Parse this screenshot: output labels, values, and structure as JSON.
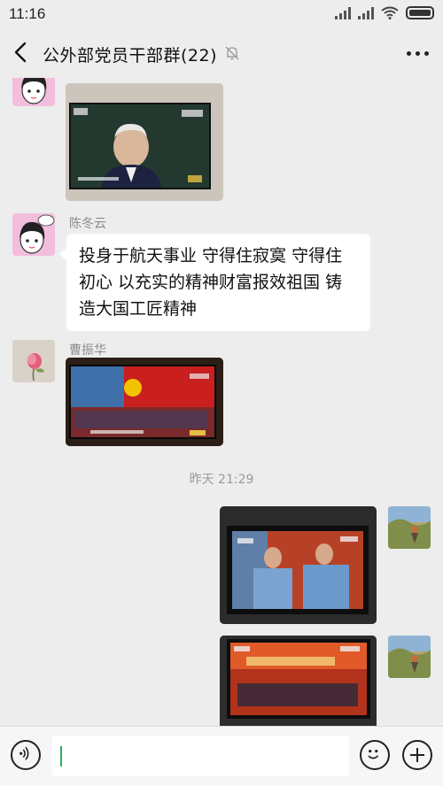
{
  "status_bar": {
    "time": "11:16",
    "icons": [
      "signal-icon",
      "signal-icon",
      "wifi-icon",
      "battery-icon"
    ]
  },
  "header": {
    "title": "公外部党员干部群(22)",
    "muted": true,
    "icons": [
      "back-arrow-icon",
      "mute-bell-icon",
      "more-dots-icon"
    ]
  },
  "messages": [
    {
      "type": "image",
      "side": "left",
      "sender": "",
      "description_icon": "tv-photo"
    },
    {
      "type": "text",
      "side": "left",
      "sender": "陈冬云",
      "text": "投身于航天事业 守得住寂寞 守得住初心 以充实的精神财富报效祖国 铸造大国工匠精神"
    },
    {
      "type": "image",
      "side": "left",
      "sender": "曹振华"
    },
    {
      "type": "timestamp",
      "text": "昨天 21:29"
    },
    {
      "type": "image",
      "side": "right",
      "sender": ""
    },
    {
      "type": "image",
      "side": "right",
      "sender": ""
    }
  ],
  "input_bar": {
    "value": "",
    "icons": [
      "voice-icon",
      "emoji-icon",
      "plus-icon"
    ]
  },
  "colors": {
    "background": "#ededed",
    "bubble": "#ffffff",
    "caret": "#2aae67"
  }
}
